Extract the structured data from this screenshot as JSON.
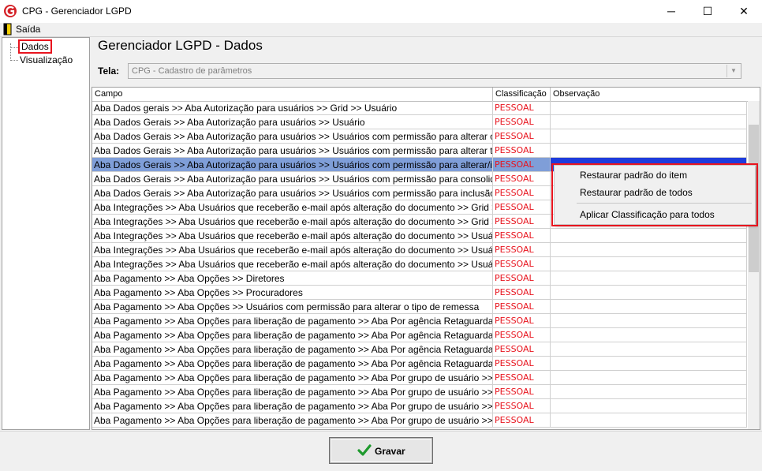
{
  "window": {
    "title": "CPG - Gerenciador LGPD",
    "minimize": "─",
    "maximize": "☐",
    "close": "✕"
  },
  "menu": {
    "exit_label": "Saída"
  },
  "tree": {
    "items": [
      "Dados",
      "Visualização"
    ]
  },
  "page": {
    "title": "Gerenciador LGPD - Dados"
  },
  "tela": {
    "label": "Tela:",
    "value": "CPG - Cadastro de parâmetros"
  },
  "grid": {
    "columns": [
      "Campo",
      "Classificação",
      "Observação"
    ],
    "rows": [
      {
        "campo": "Aba Dados gerais >> Aba Autorização para usuários >> Grid >> Usuário",
        "classificacao": "PESSOAL",
        "observacao": ""
      },
      {
        "campo": "Aba Dados Gerais >> Aba Autorização para usuários >> Usuário",
        "classificacao": "PESSOAL",
        "observacao": ""
      },
      {
        "campo": "Aba Dados Gerais >> Aba Autorização para usuários >> Usuários com permissão para alterar o valor de l...",
        "classificacao": "PESSOAL",
        "observacao": ""
      },
      {
        "campo": "Aba Dados Gerais >> Aba Autorização para usuários >> Usuários com permissão para alterar tipos de de...",
        "classificacao": "PESSOAL",
        "observacao": ""
      },
      {
        "campo": "Aba Dados Gerais >> Aba Autorização para usuários >> Usuários com permissão para alterar/incluir valor...",
        "classificacao": "PESSOAL",
        "observacao": ""
      },
      {
        "campo": "Aba Dados Gerais >> Aba Autorização para usuários >> Usuários com permissão para consolidar relatóri...",
        "classificacao": "PESSOAL",
        "observacao": ""
      },
      {
        "campo": "Aba Dados Gerais >> Aba Autorização para usuários >> Usuários com permissão para inclusão com data...",
        "classificacao": "PESSOAL",
        "observacao": ""
      },
      {
        "campo": "Aba Integrações >> Aba Usuários que receberão e-mail após alteração do documento >> Grid >> E-mail",
        "classificacao": "PESSOAL",
        "observacao": ""
      },
      {
        "campo": "Aba Integrações >> Aba Usuários que receberão e-mail após alteração do documento >> Grid >> Usuário",
        "classificacao": "PESSOAL",
        "observacao": ""
      },
      {
        "campo": "Aba Integrações >> Aba Usuários que receberão e-mail após alteração do documento >> Usuário",
        "classificacao": "PESSOAL",
        "observacao": ""
      },
      {
        "campo": "Aba Integrações >> Aba Usuários que receberão e-mail após alteração do documento >> Usuário >> Bro...",
        "classificacao": "PESSOAL",
        "observacao": ""
      },
      {
        "campo": "Aba Integrações >> Aba Usuários que receberão e-mail após alteração do documento >> Usuário >> Bro...",
        "classificacao": "PESSOAL",
        "observacao": ""
      },
      {
        "campo": "Aba Pagamento >> Aba Opções >> Diretores",
        "classificacao": "PESSOAL",
        "observacao": ""
      },
      {
        "campo": "Aba Pagamento >> Aba Opções >> Procuradores",
        "classificacao": "PESSOAL",
        "observacao": ""
      },
      {
        "campo": "Aba Pagamento >> Aba Opções >> Usuários com permissão para alterar o tipo de remessa",
        "classificacao": "PESSOAL",
        "observacao": ""
      },
      {
        "campo": "Aba Pagamento >> Aba Opções para liberação de pagamento >> Aba Por agência Retaguarda >> Grid ...",
        "classificacao": "PESSOAL",
        "observacao": ""
      },
      {
        "campo": "Aba Pagamento >> Aba Opções para liberação de pagamento >> Aba Por agência Retaguarda >> Grid ...",
        "classificacao": "PESSOAL",
        "observacao": ""
      },
      {
        "campo": "Aba Pagamento >> Aba Opções para liberação de pagamento >> Aba Por agência Retaguarda >> Grid ...",
        "classificacao": "PESSOAL",
        "observacao": ""
      },
      {
        "campo": "Aba Pagamento >> Aba Opções para liberação de pagamento >> Aba Por agência Retaguarda >> Grid ...",
        "classificacao": "PESSOAL",
        "observacao": ""
      },
      {
        "campo": "Aba Pagamento >> Aba Opções para liberação de pagamento >> Aba Por grupo de usuário >> Grid Seto...",
        "classificacao": "PESSOAL",
        "observacao": ""
      },
      {
        "campo": "Aba Pagamento >> Aba Opções para liberação de pagamento >> Aba Por grupo de usuário >> Grid Seto...",
        "classificacao": "PESSOAL",
        "observacao": ""
      },
      {
        "campo": "Aba Pagamento >> Aba Opções para liberação de pagamento >> Aba Por grupo de usuário >> Grid Usu...",
        "classificacao": "PESSOAL",
        "observacao": ""
      },
      {
        "campo": "Aba Pagamento >> Aba Opções para liberação de pagamento >> Aba Por grupo de usuário >> Grid Usu...",
        "classificacao": "PESSOAL",
        "observacao": ""
      }
    ]
  },
  "context_menu": {
    "items": [
      "Restaurar padrão do item",
      "Restaurar padrão de todos",
      "Aplicar Classificação para todos"
    ]
  },
  "save_button": {
    "label": "Gravar",
    "icon": "checkmark-icon"
  },
  "colors": {
    "accent_red": "#e8141e",
    "selection": "#7f9ed8",
    "checkmark": "#1f9a2e"
  }
}
